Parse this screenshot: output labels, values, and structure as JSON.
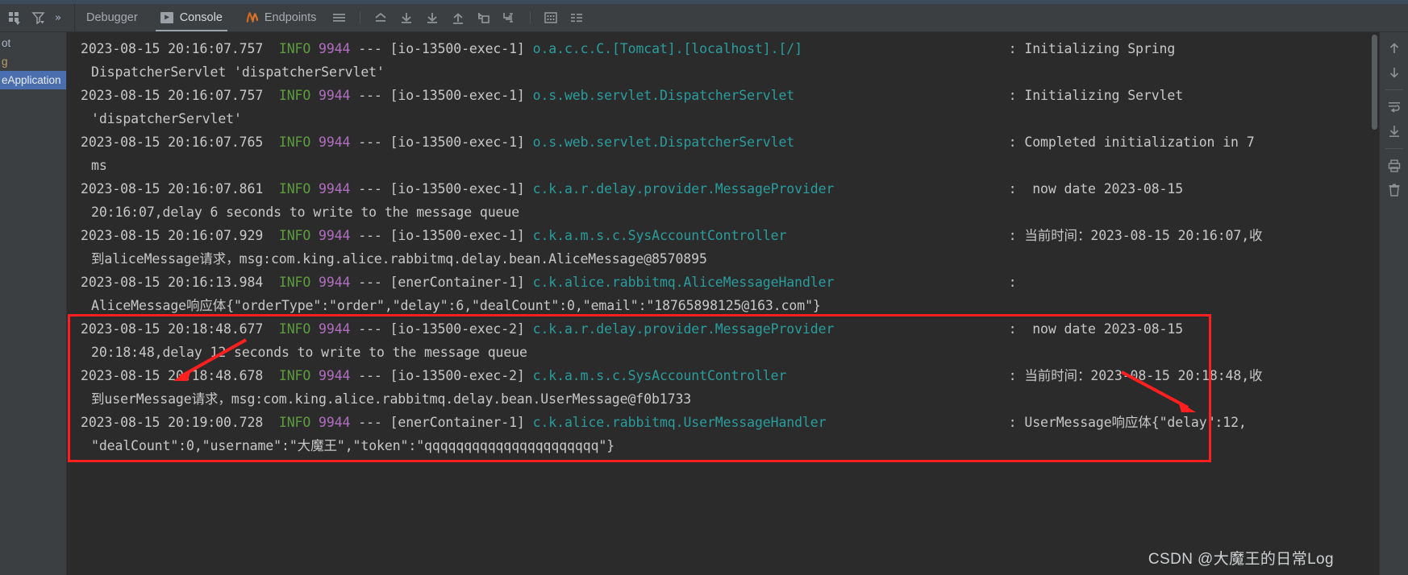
{
  "window": {
    "accent_red": "#ff1f1f",
    "background": "#3c3f41",
    "console_background": "#2b2b2b"
  },
  "toolbar": {
    "left_icons": [
      {
        "name": "layout-icon",
        "glyph": "grid"
      },
      {
        "name": "filter-icon",
        "glyph": "funnel"
      }
    ],
    "overflow_label": "»",
    "tabs": [
      {
        "label": "Debugger",
        "icon": "debugger-icon",
        "active": false
      },
      {
        "label": "Console",
        "icon": "console-icon",
        "active": true
      },
      {
        "label": "Endpoints",
        "icon": "endpoints-icon",
        "active": false
      }
    ],
    "actions": [
      {
        "name": "menu-icon"
      },
      {
        "name": "step-out-icon"
      },
      {
        "name": "step-over-icon"
      },
      {
        "name": "step-into-icon"
      },
      {
        "name": "force-step-into-icon"
      },
      {
        "name": "run-to-cursor-icon"
      },
      {
        "name": "drop-frame-icon"
      },
      {
        "name": "evaluate-icon"
      },
      {
        "name": "settings-lines-icon"
      }
    ]
  },
  "left_panel": {
    "rows": [
      {
        "label": "ot",
        "style": "normal"
      },
      {
        "label": "g",
        "style": "dim"
      },
      {
        "label": "eApplication",
        "style": "selected"
      }
    ]
  },
  "right_gutter": {
    "icons": [
      {
        "name": "scroll-up-icon"
      },
      {
        "name": "scroll-down-icon"
      },
      {
        "name": "soft-wrap-icon"
      },
      {
        "name": "scroll-to-end-icon"
      },
      {
        "name": "print-icon"
      },
      {
        "name": "clear-all-icon"
      }
    ]
  },
  "console": {
    "lines": [
      {
        "type": "log",
        "ts": "2023-08-15 20:16:07.757",
        "level": "INFO",
        "pid": "9944",
        "thread": "[io-13500-exec-1]",
        "logger": "o.a.c.c.C.[Tomcat].[localhost].[/]",
        "sep": ":",
        "message": "Initializing Spring",
        "highlighted": false
      },
      {
        "type": "cont",
        "text": "DispatcherServlet 'dispatcherServlet'",
        "highlighted": false
      },
      {
        "type": "log",
        "ts": "2023-08-15 20:16:07.757",
        "level": "INFO",
        "pid": "9944",
        "thread": "[io-13500-exec-1]",
        "logger": "o.s.web.servlet.DispatcherServlet",
        "sep": ":",
        "message": "Initializing Servlet",
        "highlighted": false
      },
      {
        "type": "cont",
        "text": "'dispatcherServlet'",
        "highlighted": false
      },
      {
        "type": "log",
        "ts": "2023-08-15 20:16:07.765",
        "level": "INFO",
        "pid": "9944",
        "thread": "[io-13500-exec-1]",
        "logger": "o.s.web.servlet.DispatcherServlet",
        "sep": ":",
        "message": "Completed initialization in 7",
        "highlighted": false
      },
      {
        "type": "cont",
        "text": "ms",
        "highlighted": false
      },
      {
        "type": "log",
        "ts": "2023-08-15 20:16:07.861",
        "level": "INFO",
        "pid": "9944",
        "thread": "[io-13500-exec-1]",
        "logger": "c.k.a.r.delay.provider.MessageProvider",
        "sep": ":",
        "message": " now date 2023-08-15",
        "highlighted": false
      },
      {
        "type": "cont",
        "text": "20:16:07,delay 6 seconds to write to the message queue",
        "highlighted": false
      },
      {
        "type": "log",
        "ts": "2023-08-15 20:16:07.929",
        "level": "INFO",
        "pid": "9944",
        "thread": "[io-13500-exec-1]",
        "logger": "c.k.a.m.s.c.SysAccountController",
        "sep": ":",
        "message": "当前时间：2023-08-15 20:16:07,收",
        "highlighted": false
      },
      {
        "type": "cont",
        "text": "到aliceMessage请求，msg:com.king.alice.rabbitmq.delay.bean.AliceMessage@8570895",
        "highlighted": false
      },
      {
        "type": "log",
        "ts": "2023-08-15 20:16:13.984",
        "level": "INFO",
        "pid": "9944",
        "thread": "[enerContainer-1]",
        "logger": "c.k.alice.rabbitmq.AliceMessageHandler",
        "sep": ":",
        "message": "",
        "highlighted": false
      },
      {
        "type": "cont",
        "text": "AliceMessage响应体{\"orderType\":\"order\",\"delay\":6,\"dealCount\":0,\"email\":\"18765898125@163.com\"}",
        "highlighted": false
      },
      {
        "type": "log",
        "ts": "2023-08-15 20:18:48.677",
        "level": "INFO",
        "pid": "9944",
        "thread": "[io-13500-exec-2]",
        "logger": "c.k.a.r.delay.provider.MessageProvider",
        "sep": ":",
        "message": " now date 2023-08-15",
        "highlighted": true
      },
      {
        "type": "cont",
        "text": "20:18:48,delay 12 seconds to write to the message queue",
        "highlighted": true
      },
      {
        "type": "log",
        "ts": "2023-08-15 20:18:48.678",
        "level": "INFO",
        "pid": "9944",
        "thread": "[io-13500-exec-2]",
        "logger": "c.k.a.m.s.c.SysAccountController",
        "sep": ":",
        "message": "当前时间：2023-08-15 20:18:48,收",
        "highlighted": true
      },
      {
        "type": "cont",
        "text": "到userMessage请求，msg:com.king.alice.rabbitmq.delay.bean.UserMessage@f0b1733",
        "highlighted": true
      },
      {
        "type": "log",
        "ts": "2023-08-15 20:19:00.728",
        "level": "INFO",
        "pid": "9944",
        "thread": "[enerContainer-1]",
        "logger": "c.k.alice.rabbitmq.UserMessageHandler",
        "sep": ":",
        "message": "UserMessage响应体{\"delay\":12,",
        "highlighted": true
      },
      {
        "type": "cont",
        "text": "\"dealCount\":0,\"username\":\"大魔王\",\"token\":\"qqqqqqqqqqqqqqqqqqqqqq\"}",
        "highlighted": true
      }
    ]
  },
  "annotations": {
    "box": {
      "label": "highlight-box",
      "color": "#ff1f1f"
    },
    "arrows": [
      {
        "label": "arrow-delay-12"
      },
      {
        "label": "arrow-timestamp"
      }
    ]
  },
  "watermark": {
    "text": "CSDN @大魔王的日常Log"
  }
}
